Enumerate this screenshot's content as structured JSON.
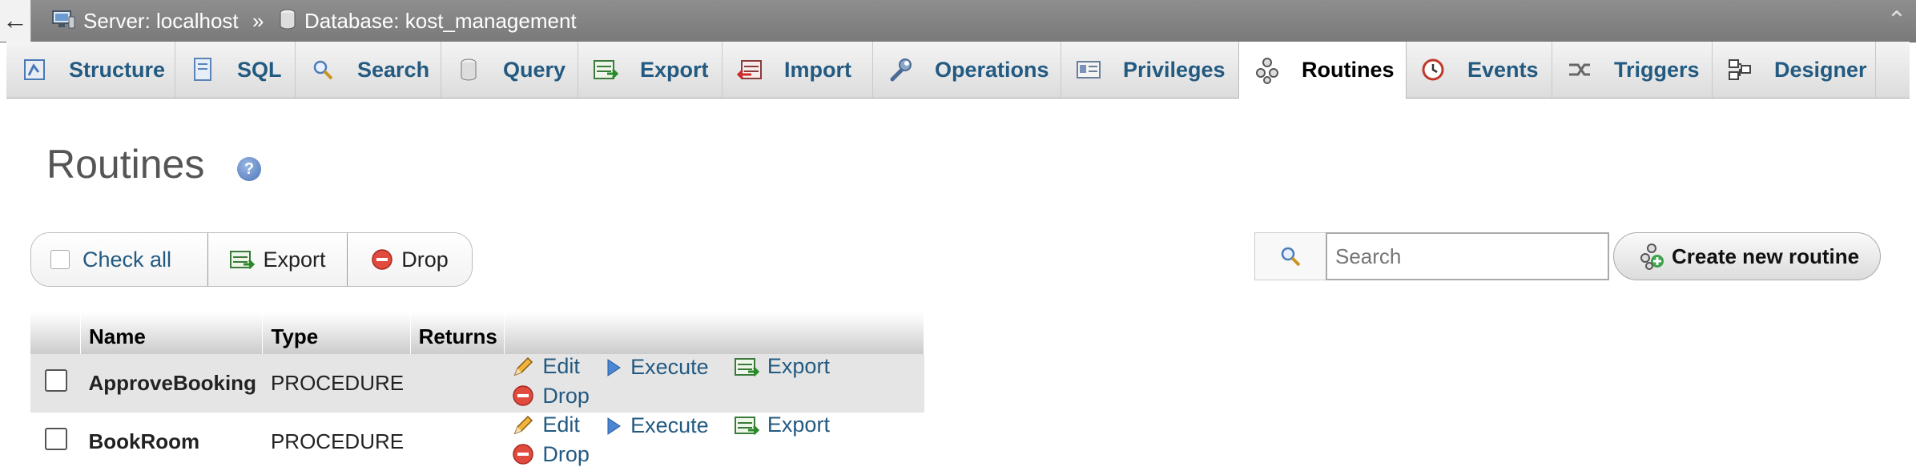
{
  "breadcrumb": {
    "server": "Server: localhost",
    "separator": "»",
    "database": "Database: kost_management"
  },
  "tabs": [
    {
      "label": "Structure",
      "icon": "structure-icon"
    },
    {
      "label": "SQL",
      "icon": "sql-icon"
    },
    {
      "label": "Search",
      "icon": "search-icon"
    },
    {
      "label": "Query",
      "icon": "query-icon"
    },
    {
      "label": "Export",
      "icon": "export-icon"
    },
    {
      "label": "Import",
      "icon": "import-icon"
    },
    {
      "label": "Operations",
      "icon": "wrench-icon"
    },
    {
      "label": "Privileges",
      "icon": "privileges-icon"
    },
    {
      "label": "Routines",
      "icon": "routines-icon",
      "active": true
    },
    {
      "label": "Events",
      "icon": "clock-icon"
    },
    {
      "label": "Triggers",
      "icon": "triggers-icon"
    },
    {
      "label": "Designer",
      "icon": "designer-icon"
    }
  ],
  "page": {
    "title": "Routines",
    "help_icon": "help-icon"
  },
  "toolbar": {
    "check_all": "Check all",
    "export": "Export",
    "drop": "Drop",
    "search_placeholder": "Search",
    "search_value": "",
    "create_routine": "Create new routine"
  },
  "table": {
    "headers": [
      "",
      "Name",
      "Type",
      "Returns",
      ""
    ],
    "rows": [
      {
        "name": "ApproveBooking",
        "type": "PROCEDURE",
        "returns": "",
        "checked": false
      },
      {
        "name": "BookRoom",
        "type": "PROCEDURE",
        "returns": "",
        "checked": false
      }
    ],
    "actions": {
      "edit": "Edit",
      "execute": "Execute",
      "export": "Export",
      "drop": "Drop"
    }
  },
  "colors": {
    "link": "#235a81",
    "topbar": "#858585",
    "row_highlight": "#e5e5e5"
  }
}
